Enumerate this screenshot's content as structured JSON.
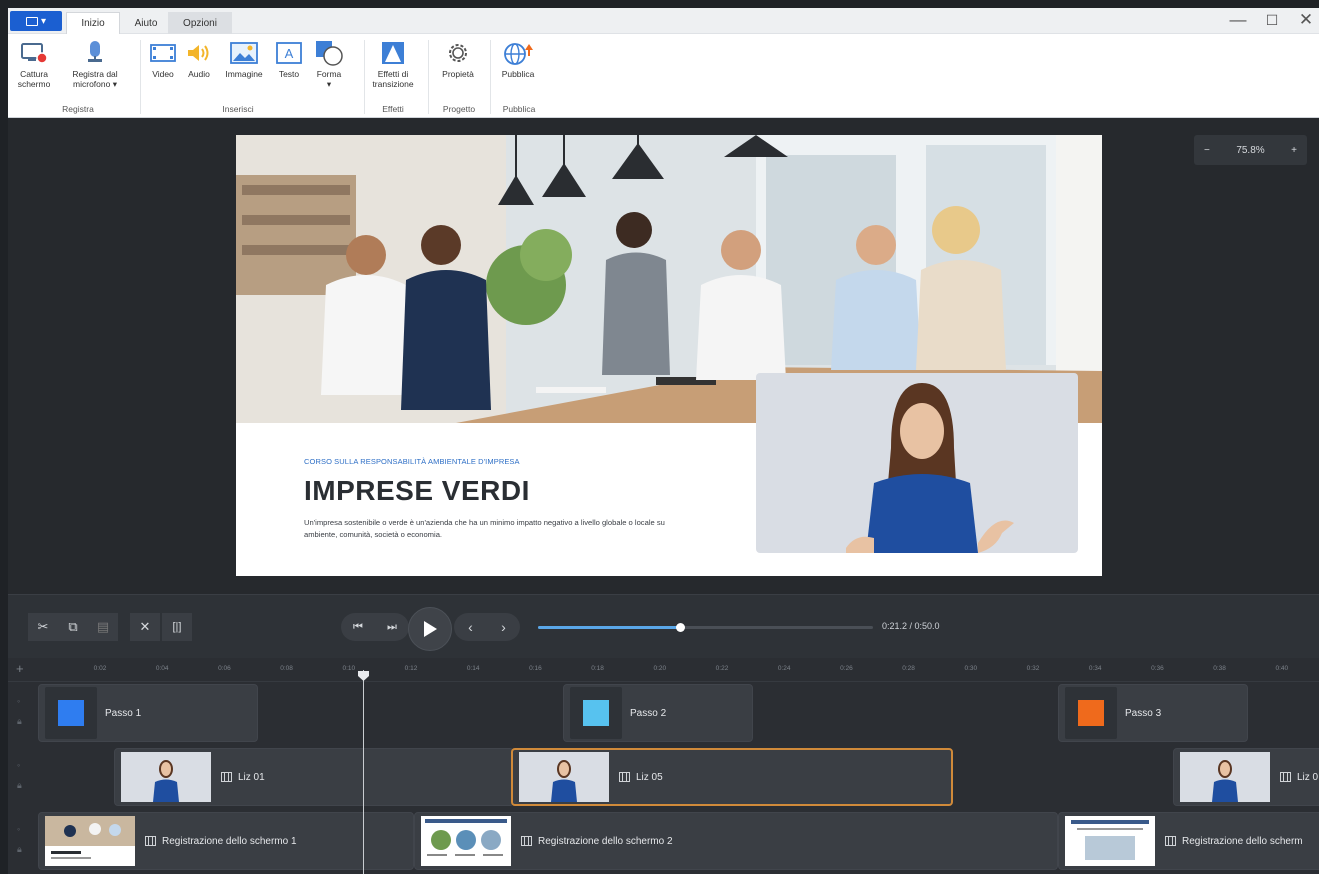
{
  "app_menu_label": "▾",
  "tabs": [
    {
      "label": "Inizio",
      "active": true
    },
    {
      "label": "Aiuto",
      "active": false
    },
    {
      "label": "Opzioni",
      "active": false
    }
  ],
  "window_controls": {
    "minimize": "—",
    "maximize": "☐",
    "close": "✕"
  },
  "ribbon": {
    "buttons": [
      {
        "label": "Cattura\nschermo",
        "icon": "screen-capture-icon"
      },
      {
        "label": "Registra dal\nmicrofono ▾",
        "icon": "microphone-icon"
      },
      {
        "label": "Video",
        "icon": "video-icon"
      },
      {
        "label": "Audio",
        "icon": "audio-icon"
      },
      {
        "label": "Immagine",
        "icon": "image-icon"
      },
      {
        "label": "Testo",
        "icon": "text-icon"
      },
      {
        "label": "Forma\n▾",
        "icon": "shape-icon"
      },
      {
        "label": "Effetti di\ntransizione",
        "icon": "transition-icon"
      },
      {
        "label": "Propietà",
        "icon": "gear-icon"
      },
      {
        "label": "Pubblica",
        "icon": "publish-globe-icon"
      }
    ],
    "groups": [
      "Registra",
      "Inserisci",
      "Effetti",
      "Progetto",
      "Pubblica"
    ]
  },
  "zoom": {
    "minus": "−",
    "value": "75.8%",
    "plus": "+"
  },
  "slide": {
    "eyebrow": "CORSO SULLA RESPONSABILITÀ AMBIENTALE D'IMPRESA",
    "title": "IMPRESE VERDI",
    "description": "Un'impresa sostenibile o verde è un'azienda che ha un minimo impatto negativo a livello globale o locale su ambiente, comunità, società o economia."
  },
  "transport": {
    "time": "0:21.2 / 0:50.0",
    "progress": 0.424,
    "edit_buttons": [
      "cut-icon",
      "copy-icon",
      "paste-icon",
      "delete-icon",
      "split-icon"
    ],
    "nav_buttons": [
      "skip-start-icon",
      "skip-end-icon"
    ],
    "step_buttons": [
      "prev-frame-icon",
      "next-frame-icon"
    ]
  },
  "ruler": {
    "ticks": [
      "0:02",
      "0:04",
      "0:06",
      "0:08",
      "0:10",
      "0:12",
      "0:14",
      "0:16",
      "0:18",
      "0:20",
      "0:22",
      "0:24",
      "0:26",
      "0:28",
      "0:30",
      "0:32",
      "0:34",
      "0:36",
      "0:38",
      "0:40"
    ]
  },
  "tracks": {
    "steps": [
      {
        "label": "Passo 1",
        "color": "#2f7df0"
      },
      {
        "label": "Passo 2",
        "color": "#57c2ef"
      },
      {
        "label": "Passo 3",
        "color": "#ef6a1c"
      }
    ],
    "lessons": [
      {
        "label": "Liz 01"
      },
      {
        "label": "Liz 05"
      },
      {
        "label": "Liz 0"
      }
    ],
    "recordings": [
      {
        "label": "Registrazione dello schermo 1"
      },
      {
        "label": "Registrazione dello schermo 2"
      },
      {
        "label": "Registrazione dello scherm"
      }
    ]
  },
  "accent_colors": {
    "selection": "#d08a3a",
    "progress": "#5aa7e8",
    "app_button": "#1b5fd1"
  }
}
